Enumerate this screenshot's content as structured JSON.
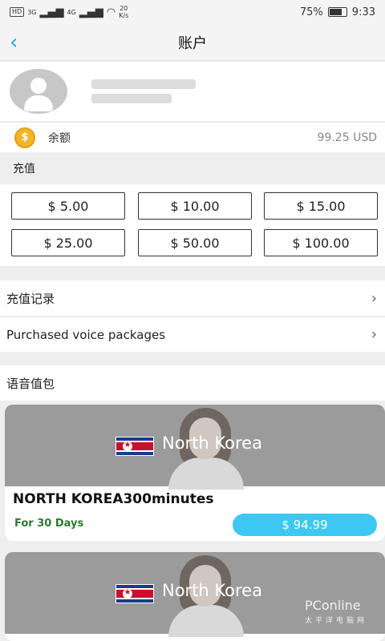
{
  "status_bar": {
    "left_chip": "HD",
    "sig1": "3G",
    "sig2": "4G",
    "speed": "20\nK/s",
    "battery": "75%",
    "time": "9:33"
  },
  "header": {
    "title": "账户"
  },
  "balance": {
    "label": "余额",
    "amount": "99.25 USD"
  },
  "recharge": {
    "section_title": "充值",
    "amounts": [
      "$ 5.00",
      "$ 10.00",
      "$ 15.00",
      "$ 25.00",
      "$ 50.00",
      "$ 100.00"
    ]
  },
  "menu": {
    "items": [
      {
        "label": "充值记录"
      },
      {
        "label": "Purchased voice packages"
      }
    ]
  },
  "packages": {
    "section_title": "语音值包",
    "cards": [
      {
        "country": "North Korea",
        "name": "NORTH KOREA300minutes",
        "days": "For 30 Days",
        "price": "$ 94.99"
      },
      {
        "country": "North Korea"
      }
    ]
  },
  "watermark": {
    "brand": "PConline",
    "sub": "太平洋电脑网"
  },
  "colors": {
    "accent": "#3cc8f2",
    "back": "#27a9e0",
    "days": "#2c7a2f"
  },
  "battery_level": 0.75
}
